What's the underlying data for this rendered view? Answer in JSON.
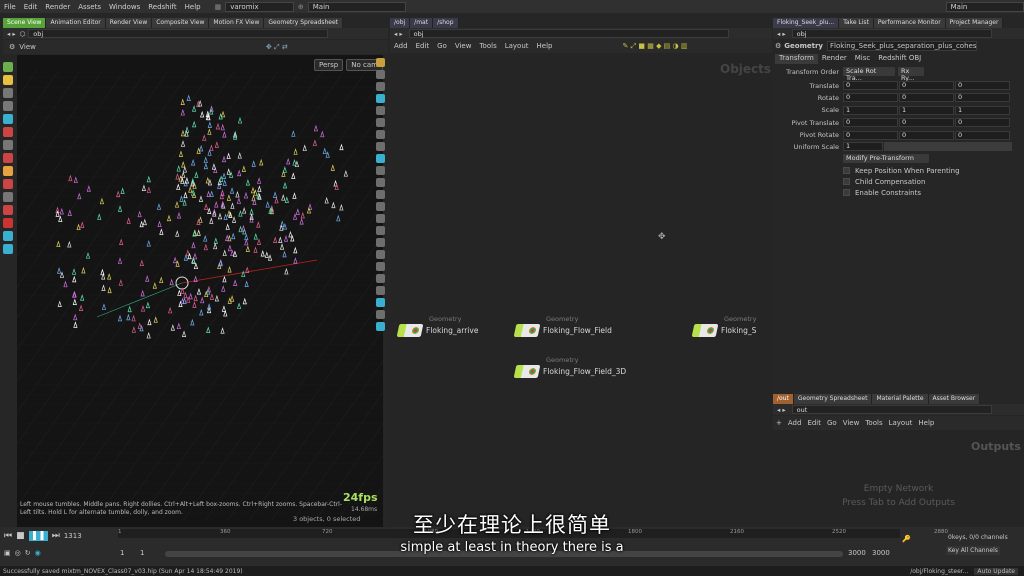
{
  "menubar": {
    "items": [
      "File",
      "Edit",
      "Render",
      "Assets",
      "Windows",
      "Redshift",
      "Help"
    ],
    "desktop": "varomix",
    "main": "Main"
  },
  "left_tabs": [
    "Scene View",
    "Animation Editor",
    "Render View",
    "Composite View",
    "Motion FX View",
    "Geometry Spreadsheet"
  ],
  "ne_tabs": [
    "/obj",
    "/mat",
    "/shop"
  ],
  "parm_tabs": [
    "Floking_Seek_plu...",
    "Take List",
    "Performance Monitor",
    "Project Manager"
  ],
  "viewport": {
    "path": "obj",
    "title": "View",
    "persp": "Persp",
    "cam": "No cam",
    "fps": "24fps",
    "ms": "14.68ms",
    "selected": "3 objects, 0 selected",
    "hint": "Left mouse tumbles. Middle pans. Right dollies. Ctrl+Alt+Left box-zooms. Ctrl+Right zooms. Spacebar-Ctrl-Left tilts. Hold L for alternate tumble, dolly, and zoom."
  },
  "network": {
    "path": "obj",
    "menu": [
      "Add",
      "Edit",
      "Go",
      "View",
      "Tools",
      "Layout",
      "Help"
    ],
    "context": "Objects",
    "nodes": [
      {
        "type": "Geometry",
        "name": "Floking_arrive"
      },
      {
        "type": "Geometry",
        "name": "Floking_Flow_Field"
      },
      {
        "type": "Geometry",
        "name": "Floking_S"
      },
      {
        "type": "Geometry",
        "name": "Floking_Flow_Field_3D"
      }
    ]
  },
  "parms": {
    "path": "obj",
    "kind": "Geometry",
    "node": "Floking_Seek_plus_separation_plus_cohes",
    "tabs": [
      "Transform",
      "Render",
      "Misc",
      "Redshift OBJ"
    ],
    "transform_order_label": "Transform Order",
    "transform_order": "Scale Rot Tra...",
    "rot_order": "Rx Ry...",
    "rows": [
      {
        "label": "Translate",
        "v": [
          "0",
          "0",
          "0"
        ]
      },
      {
        "label": "Rotate",
        "v": [
          "0",
          "0",
          "0"
        ]
      },
      {
        "label": "Scale",
        "v": [
          "1",
          "1",
          "1"
        ]
      },
      {
        "label": "Pivot Translate",
        "v": [
          "0",
          "0",
          "0"
        ]
      },
      {
        "label": "Pivot Rotate",
        "v": [
          "0",
          "0",
          "0"
        ]
      }
    ],
    "uniform_label": "Uniform Scale",
    "uniform": "1",
    "modify": "Modify Pre-Transform",
    "checks": [
      "Keep Position When Parenting",
      "Child Compensation",
      "Enable Constraints"
    ]
  },
  "lower_net": {
    "tabs": [
      "/out",
      "Geometry Spreadsheet",
      "Material Palette",
      "Asset Browser"
    ],
    "path": "out",
    "menu": [
      "Add",
      "Edit",
      "Go",
      "View",
      "Tools",
      "Layout",
      "Help"
    ],
    "context": "Outputs",
    "empty1": "Empty Network",
    "empty2": "Press Tab to Add Outputs"
  },
  "timeline": {
    "frame": "1313",
    "start": "1",
    "start2": "1",
    "ticks": [
      "1",
      "360",
      "720",
      "1080",
      "1440",
      "1800",
      "2160",
      "2520",
      "2880"
    ],
    "end": "3000",
    "end2": "3000",
    "keys": "0keys, 0/0 channels",
    "keyall": "Key All Channels",
    "auto": "Auto Update"
  },
  "status": {
    "msg": "Successfully saved mixtm_NOVEX_Class07_v03.hip (Sun Apr 14 18:54:49 2019)",
    "path": "/obj/Floking_steer..."
  },
  "subtitle": {
    "cn": "至少在理论上很简单",
    "en": "simple at least in theory there is a"
  }
}
